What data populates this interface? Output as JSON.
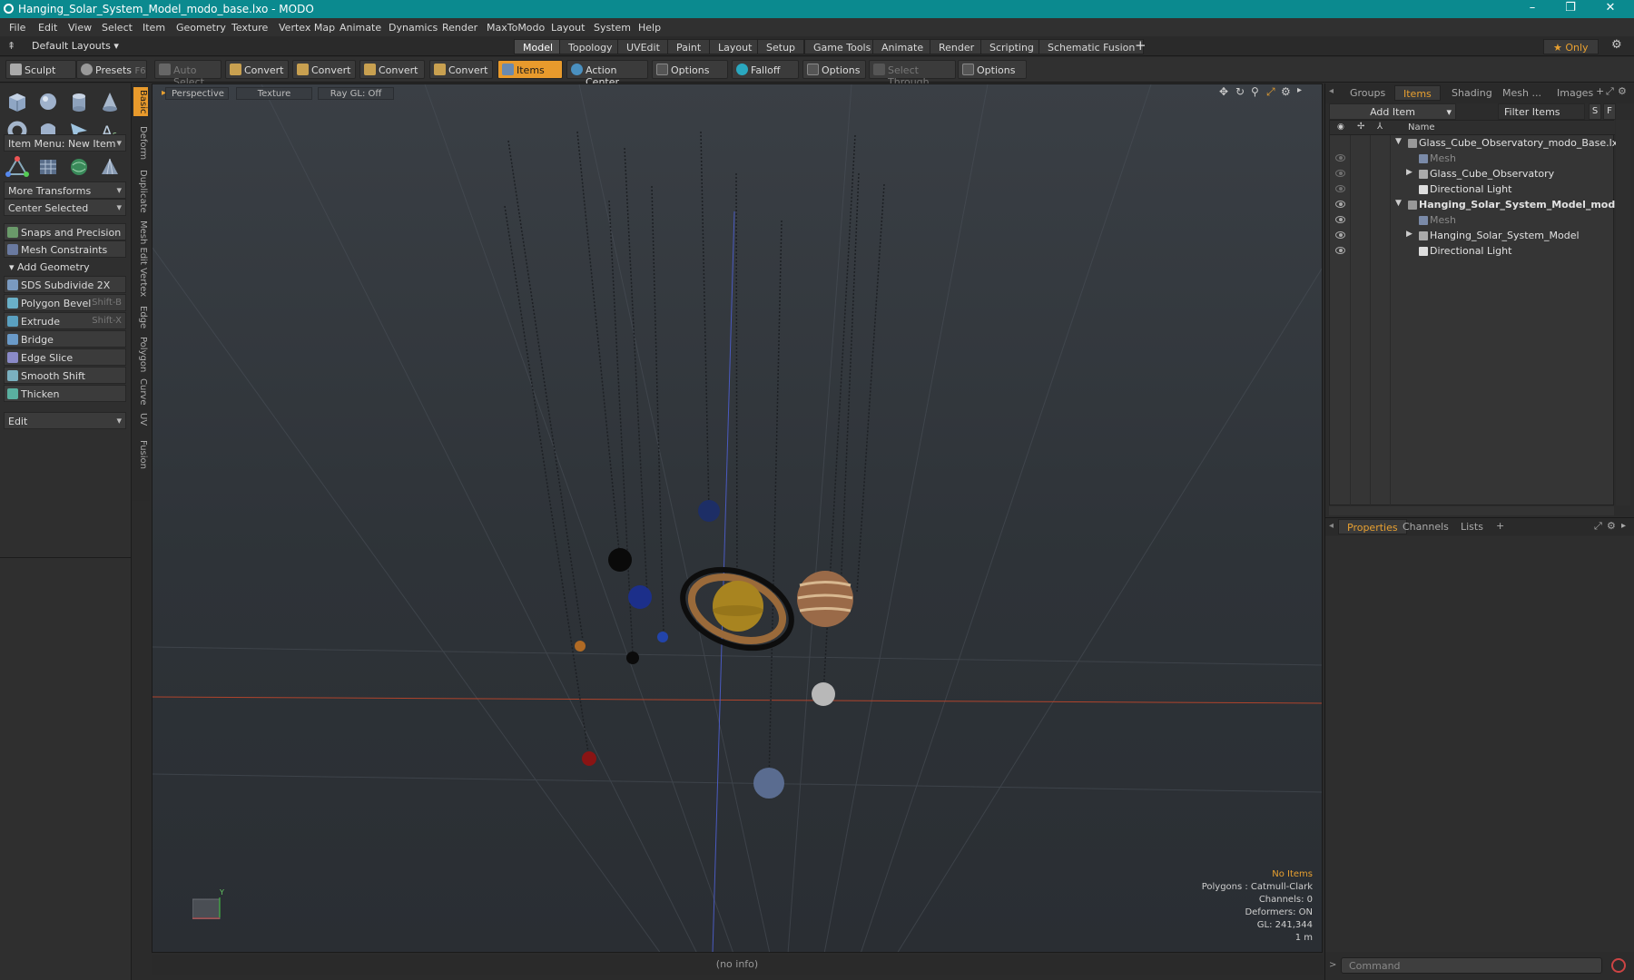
{
  "window": {
    "title": "Hanging_Solar_System_Model_modo_base.lxo - MODO",
    "controls": [
      "–",
      "❐",
      "✕"
    ]
  },
  "menu": [
    "File",
    "Edit",
    "View",
    "Select",
    "Item",
    "Geometry",
    "Texture",
    "Vertex Map",
    "Animate",
    "Dynamics",
    "Render",
    "MaxToModo",
    "Layout",
    "System",
    "Help"
  ],
  "layout_selector": "Default Layouts",
  "layout_tabs": [
    "Model",
    "Topology",
    "UVEdit",
    "Paint",
    "Layout",
    "Setup",
    "Game Tools",
    "Animate",
    "Render",
    "Scripting",
    "Schematic Fusion"
  ],
  "layout_tab_add": "+",
  "only_button": "★ Only",
  "toolbar": {
    "sculpt": "Sculpt",
    "presets": "Presets",
    "presets_shortcut": "F6",
    "auto_select": "Auto Select",
    "convert1": "Convert",
    "convert2": "Convert",
    "convert3": "Convert",
    "convert4": "Convert",
    "items": "Items",
    "action_center": "Action Center",
    "options1": "Options",
    "falloff": "Falloff",
    "options2": "Options",
    "select_through": "Select Through",
    "options3": "Options"
  },
  "left_panel": {
    "item_menu": "Item Menu: New Item",
    "more_transforms": "More Transforms",
    "center_selected": "Center Selected",
    "snaps": "Snaps and Precision",
    "mesh_constraints": "Mesh Constraints",
    "add_geometry": "Add Geometry",
    "tools": [
      {
        "label": "SDS Subdivide 2X",
        "shortcut": ""
      },
      {
        "label": "Polygon Bevel",
        "shortcut": "Shift-B"
      },
      {
        "label": "Extrude",
        "shortcut": "Shift-X"
      },
      {
        "label": "Bridge",
        "shortcut": ""
      },
      {
        "label": "Edge Slice",
        "shortcut": ""
      },
      {
        "label": "Smooth Shift",
        "shortcut": ""
      },
      {
        "label": "Thicken",
        "shortcut": ""
      }
    ],
    "edit_dropdown": "Edit"
  },
  "vertical_tabs": [
    "Basic",
    "Deform",
    "Duplicate",
    "Mesh Edit",
    "Vertex",
    "Edge",
    "Polygon",
    "Curve",
    "UV",
    "Fusion"
  ],
  "viewport": {
    "view": "Perspective",
    "shading": "Texture",
    "raygl": "Ray GL: Off",
    "info": {
      "selection": "No Items",
      "polygons": "Polygons : Catmull-Clark",
      "channels": "Channels: 0",
      "deformers": "Deformers: ON",
      "gl": "GL: 241,344",
      "scale": "1 m"
    },
    "axis_label": "Y"
  },
  "status": "(no info)",
  "right_panel": {
    "tabs": [
      "Groups",
      "Items",
      "Shading",
      "Mesh ...",
      "Images"
    ],
    "add_item": "Add Item",
    "filter_items": "Filter Items",
    "filter_s": "S",
    "filter_f": "F",
    "column_name": "Name",
    "tree": [
      {
        "label": "Glass_Cube_Observatory_modo_Base.lxo",
        "level": 0,
        "bold": false,
        "dim": false
      },
      {
        "label": "Mesh",
        "level": 1,
        "bold": false,
        "dim": true
      },
      {
        "label": "Glass_Cube_Observatory",
        "level": 1,
        "bold": false,
        "dim": false
      },
      {
        "label": "Directional Light",
        "level": 1,
        "bold": false,
        "dim": false
      },
      {
        "label": "Hanging_Solar_System_Model_mod...",
        "level": 0,
        "bold": true,
        "dim": false
      },
      {
        "label": "Mesh",
        "level": 1,
        "bold": false,
        "dim": true
      },
      {
        "label": "Hanging_Solar_System_Model",
        "level": 1,
        "bold": false,
        "dim": false
      },
      {
        "label": "Directional Light",
        "level": 1,
        "bold": false,
        "dim": false
      }
    ],
    "props_tabs": [
      "Properties",
      "Channels",
      "Lists"
    ],
    "command_placeholder": "Command"
  }
}
